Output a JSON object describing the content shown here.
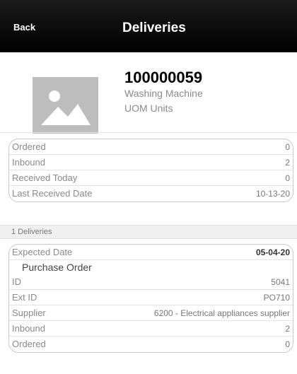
{
  "header": {
    "back_label": "Back",
    "title": "Deliveries"
  },
  "product": {
    "id": "100000059",
    "name": "Washing Machine",
    "uom": "UOM Units",
    "image_icon": "image-placeholder-icon"
  },
  "summary": [
    {
      "label": "Ordered",
      "value": "0"
    },
    {
      "label": "Inbound",
      "value": "2"
    },
    {
      "label": "Received Today",
      "value": "0"
    },
    {
      "label": "Last Received Date",
      "value": "10-13-20"
    }
  ],
  "deliveries_header": "1 Deliveries",
  "delivery": {
    "expected_label": "Expected Date",
    "expected_value": "05-04-20",
    "po_heading": "Purchase Order",
    "fields": [
      {
        "label": "ID",
        "value": "5041"
      },
      {
        "label": "Ext ID",
        "value": "PO710"
      },
      {
        "label": "Supplier",
        "value": "6200 - Electrical appliances supplier"
      },
      {
        "label": "Inbound",
        "value": "2"
      },
      {
        "label": "Ordered",
        "value": "0"
      }
    ]
  }
}
